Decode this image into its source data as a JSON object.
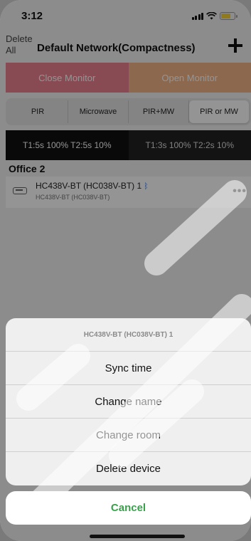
{
  "status": {
    "time": "3:12"
  },
  "nav": {
    "delete_all": "Delete All",
    "title": "Default Network(Compactness)"
  },
  "monitor": {
    "close": "Close Monitor",
    "open": "Open Monitor"
  },
  "modes": [
    "PIR",
    "Microwave",
    "PIR+MW",
    "PIR or MW"
  ],
  "active_mode": "PIR or MW",
  "timers": {
    "left": "T1:5s 100%  T2:5s 10%",
    "right": "T1:3s 100%  T2:2s 10%"
  },
  "room": "Office 2",
  "device": {
    "name": "HC438V-BT (HC038V-BT) 1",
    "model": "HC438V-BT (HC038V-BT)",
    "more": "•••"
  },
  "sheet": {
    "title": "HC438V-BT (HC038V-BT) 1",
    "items": [
      "Sync time",
      "Change name",
      "Change room",
      "Delete device"
    ],
    "cancel": "Cancel"
  },
  "colors": {
    "close_monitor": "#ec8190",
    "open_monitor": "#f2b487",
    "cancel_text": "#37a24a",
    "battery": "#f6d334"
  }
}
